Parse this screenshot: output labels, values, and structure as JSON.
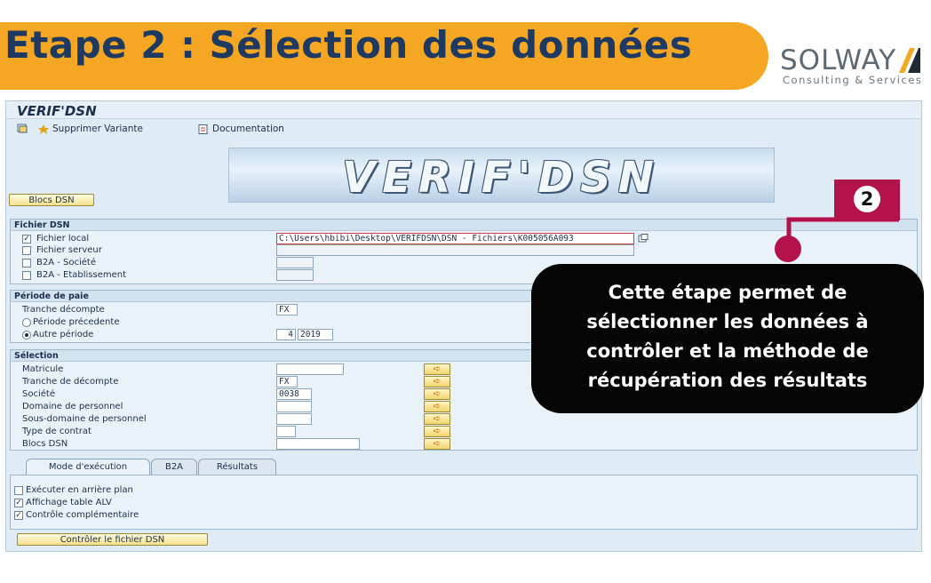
{
  "banner": {
    "title": "Etape 2 : Sélection des données",
    "color": "#f5a623"
  },
  "logo": {
    "word": "SOLWAY",
    "subtitle": "Consulting & Services"
  },
  "window": {
    "title": "VERIF'DSN",
    "toolbar": {
      "variant_label": "Supprimer Variante",
      "doc_label": "Documentation"
    },
    "hero_text": "VERIF'DSN",
    "blocs_button": "Blocs DSN"
  },
  "fichier": {
    "header": "Fichier DSN",
    "rows": [
      {
        "label": "Fichier local",
        "checked": "✓"
      },
      {
        "label": "Fichier serveur",
        "checked": ""
      },
      {
        "label": "B2A - Société",
        "checked": ""
      },
      {
        "label": "B2A - Etablissement",
        "checked": ""
      }
    ],
    "path_value": "C:\\Users\\hbibi\\Desktop\\VERIFDSN\\DSN - Fichiers\\K005056A093"
  },
  "periode": {
    "header": "Période de paie",
    "tranche_label": "Tranche décompte",
    "tranche_value": "FX",
    "prec_label": "Période précedente",
    "autre_label": "Autre période",
    "month": "4",
    "year": "2019"
  },
  "selection": {
    "header": "Sélection",
    "rows": [
      {
        "label": "Matricule",
        "value": ""
      },
      {
        "label": "Tranche de décompte",
        "value": "FX"
      },
      {
        "label": "Société",
        "value": "0038"
      },
      {
        "label": "Domaine de personnel",
        "value": ""
      },
      {
        "label": "Sous-domaine de personnel",
        "value": ""
      },
      {
        "label": "Type de contrat",
        "value": ""
      },
      {
        "label": "Blocs DSN",
        "value": ""
      }
    ]
  },
  "tabs": {
    "t1": "Mode d'exécution",
    "t2": "B2A",
    "t3": "Résultats"
  },
  "options": [
    {
      "label": "Exécuter en arrière plan",
      "checked": ""
    },
    {
      "label": "Affichage table ALV",
      "checked": "✓"
    },
    {
      "label": "Contrôle complémentaire",
      "checked": "✓"
    }
  ],
  "run_button": "Contrôler le fichier DSN",
  "callout": {
    "step": "2",
    "line1": "Cette étape permet de",
    "line2": "sélectionner les données à",
    "line3": "contrôler et la méthode de",
    "line4": "récupération des résultats",
    "accent": "#b3124a"
  }
}
